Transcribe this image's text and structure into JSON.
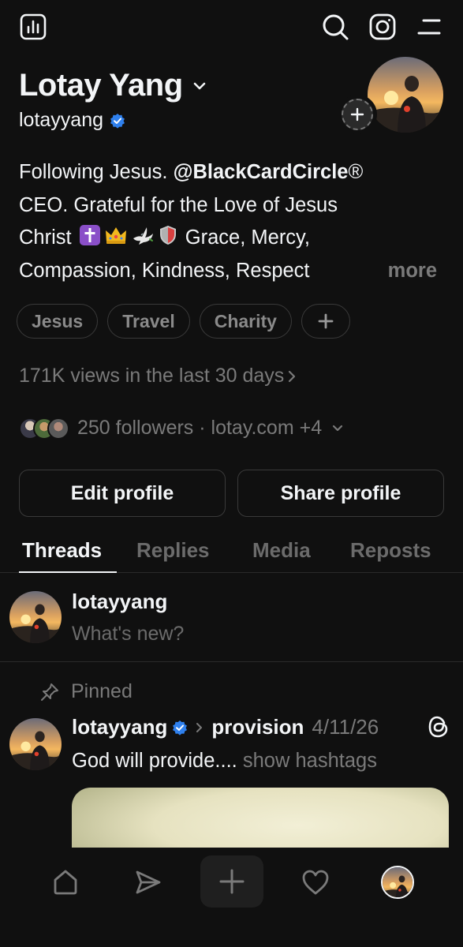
{
  "header": {
    "name": "Lotay Yang",
    "handle": "lotayyang"
  },
  "bio": {
    "line1_pre": "Following Jesus. ",
    "mention": "@BlackCardCircle",
    "registered": "®",
    "line2": "CEO. Grateful for the Love of Jesus",
    "line3_pre": "Christ ",
    "line3_post": " Grace, Mercy,",
    "line4": "Compassion, Kindness, Respect",
    "more": "more"
  },
  "chips": [
    "Jesus",
    "Travel",
    "Charity"
  ],
  "views": "171K views in the last 30 days",
  "followers": "250 followers · lotay.com +4",
  "buttons": {
    "edit": "Edit profile",
    "share": "Share profile"
  },
  "tabs": [
    "Threads",
    "Replies",
    "Media",
    "Reposts"
  ],
  "composer": {
    "user": "lotayyang",
    "placeholder": "What's new?"
  },
  "post": {
    "pinned_label": "Pinned",
    "user": "lotayyang",
    "topic": "provision",
    "date": "4/11/26",
    "text": "God will provide....",
    "hashtags": "show hashtags"
  },
  "colors": {
    "background": "#101010",
    "verified": "#2f80ed",
    "text_primary": "#f3f5f7",
    "text_secondary": "#7a7a7a"
  },
  "icons": {
    "top_left": "insights-icon",
    "search": "search-icon",
    "instagram": "instagram-icon",
    "menu": "menu-icon",
    "nav": [
      "home-icon",
      "send-icon",
      "plus-icon",
      "heart-icon",
      "profile-avatar"
    ]
  }
}
